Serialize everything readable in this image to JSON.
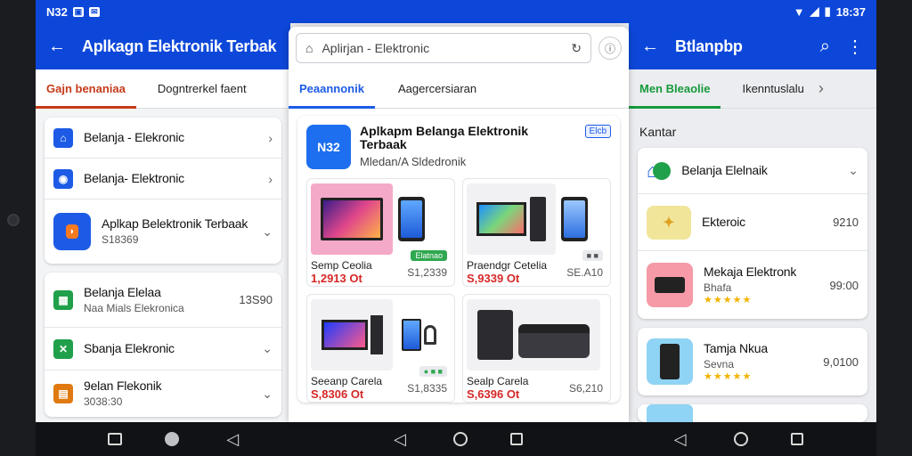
{
  "status": {
    "left": "N32",
    "time": "18:37"
  },
  "panel1": {
    "title": "Aplkagn Elektronik Terbak",
    "tabs": [
      "Gajn benaniaa",
      "Dogntrerkel faent"
    ],
    "card1": [
      {
        "t1": "Belanja - Elekronic",
        "color": "#1d5be6"
      },
      {
        "t1": "Belanja- Elektronic",
        "color": "#1d5be6"
      },
      {
        "t1": "Aplkap Belektronik Terbaak",
        "t2": "S18369",
        "color": "#1d5be6"
      }
    ],
    "card2": [
      {
        "t1": "Belanja Elelaa",
        "t2": "Naa Mials Elekronica",
        "val": "13S90",
        "color": "#20a04a"
      },
      {
        "t1": "Sbanja Elekronic",
        "color": "#20a04a"
      },
      {
        "t1": "9elan Flekonik",
        "t2": "3038:30",
        "color": "#e07a10"
      }
    ]
  },
  "panel2": {
    "search_text": "Aplirjan - Elektronic",
    "tabs": [
      "Peaannonik",
      "Aagercersiaran"
    ],
    "hero": {
      "title": "Aplkapm Belanga Elektronik Terbaak",
      "sub": "Mledan/A Sldedronik",
      "badge": "Elcb",
      "icon_text": "N32"
    },
    "products": [
      {
        "name": "Semp Ceolia",
        "price": "1,2913 Ot",
        "alt": "S1,2339",
        "pill": "Elatnao"
      },
      {
        "name": "Praendgr Cetelia",
        "price": "S,9339 Ot",
        "alt": "SE.A10",
        "pill": "■ ■"
      },
      {
        "name": "Seeanp Carela",
        "price": "S,8306 Ot",
        "alt": "S1,8335",
        "pill": "● ■ ■"
      },
      {
        "name": "Sealp Carela",
        "price": "S,6396 Ot",
        "alt": "S6,210",
        "pill": ""
      }
    ]
  },
  "panel3": {
    "title": "Btlanpbp",
    "tabs": [
      "Men Bleaolie",
      "Ikenntuslalu"
    ],
    "section": "Kantar",
    "top_item": "Belanja Elelnaik",
    "items": [
      {
        "name": "Ekteroic",
        "val": "9210"
      },
      {
        "name": "Mekaja Elektronk",
        "sub": "Bhafa",
        "val": "99:00"
      },
      {
        "name": "Tamja Nkua",
        "sub": "Sevna",
        "val": "9,0100"
      }
    ]
  },
  "colors": {
    "primary": "#0d47d9",
    "accent_red": "#c53a1a",
    "accent_green": "#169a3c",
    "price": "#d62828"
  }
}
